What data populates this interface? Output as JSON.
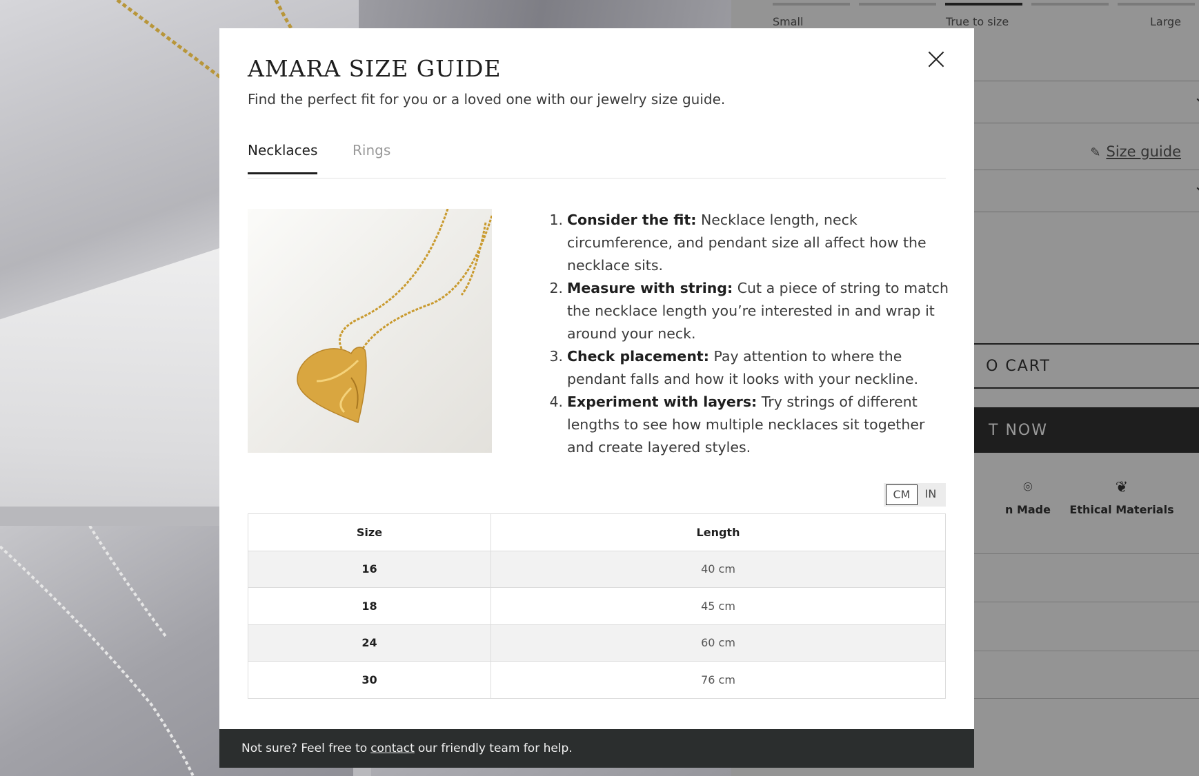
{
  "background": {
    "fit_scale": {
      "labels": [
        "Small",
        "True to size",
        "Large"
      ],
      "active_index": 2
    },
    "size_guide_link": "Size guide",
    "add_to_cart_visible": "O CART",
    "buy_now_visible": "T NOW",
    "features": [
      "n Made",
      "Ethical Materials"
    ]
  },
  "modal": {
    "title": "AMARA SIZE GUIDE",
    "subtitle": "Find the perfect fit for you or a loved one with our jewelry size guide.",
    "tabs": [
      {
        "label": "Necklaces",
        "active": true
      },
      {
        "label": "Rings",
        "active": false
      }
    ],
    "steps": [
      {
        "num": "1.",
        "heading": "Consider the fit:",
        "text": "Necklace length, neck circumference, and pendant size all affect how the necklace sits."
      },
      {
        "num": "2.",
        "heading": "Measure with string:",
        "text": "Cut a piece of string to match the necklace length you’re interested in and wrap it around your neck."
      },
      {
        "num": "3.",
        "heading": "Check placement:",
        "text": "Pay attention to where the pendant falls and how it looks with your neckline."
      },
      {
        "num": "4.",
        "heading": "Experiment with layers:",
        "text": "Try strings of different lengths to see how multiple necklaces sit together and create layered styles."
      }
    ],
    "units": {
      "cm": "CM",
      "in": "IN",
      "selected": "CM"
    },
    "table": {
      "headers": [
        "Size",
        "Length"
      ],
      "rows": [
        {
          "size": "16",
          "length": "40 cm"
        },
        {
          "size": "18",
          "length": "45 cm"
        },
        {
          "size": "24",
          "length": "60 cm"
        },
        {
          "size": "30",
          "length": "76 cm"
        }
      ]
    },
    "footer": {
      "before": "Not sure? Feel free to",
      "link": "contact",
      "after": "our friendly team for help."
    }
  }
}
